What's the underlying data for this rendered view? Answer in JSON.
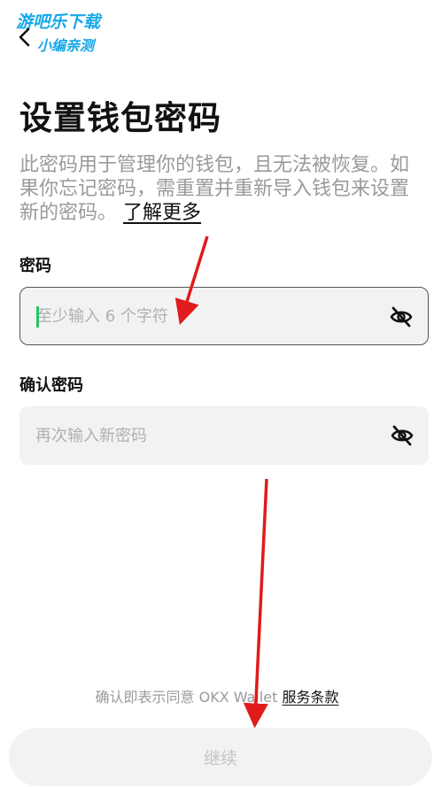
{
  "watermark": {
    "line1": "游吧乐下载",
    "line2": "小编亲测"
  },
  "header": {
    "back_icon": "chevron-left-icon"
  },
  "page": {
    "title": "设置钱包密码",
    "description": "此密码用于管理你的钱包，且无法被恢复。如果你忘记密码，需重置并重新导入钱包来设置新的密码。",
    "learn_more": "了解更多"
  },
  "fields": {
    "password": {
      "label": "密码",
      "placeholder": "至少输入 6 个字符",
      "value": "",
      "toggle_icon": "eye-off-icon"
    },
    "confirm": {
      "label": "确认密码",
      "placeholder": "再次输入新密码",
      "value": "",
      "toggle_icon": "eye-off-icon"
    }
  },
  "footer": {
    "terms_prefix": "确认即表示同意 OKX Wallet ",
    "terms_link": "服务条款",
    "continue_label": "继续"
  },
  "colors": {
    "accent_caret": "#27c467",
    "annotation_arrow": "#e01b1b",
    "watermark": "#16a8e8"
  }
}
